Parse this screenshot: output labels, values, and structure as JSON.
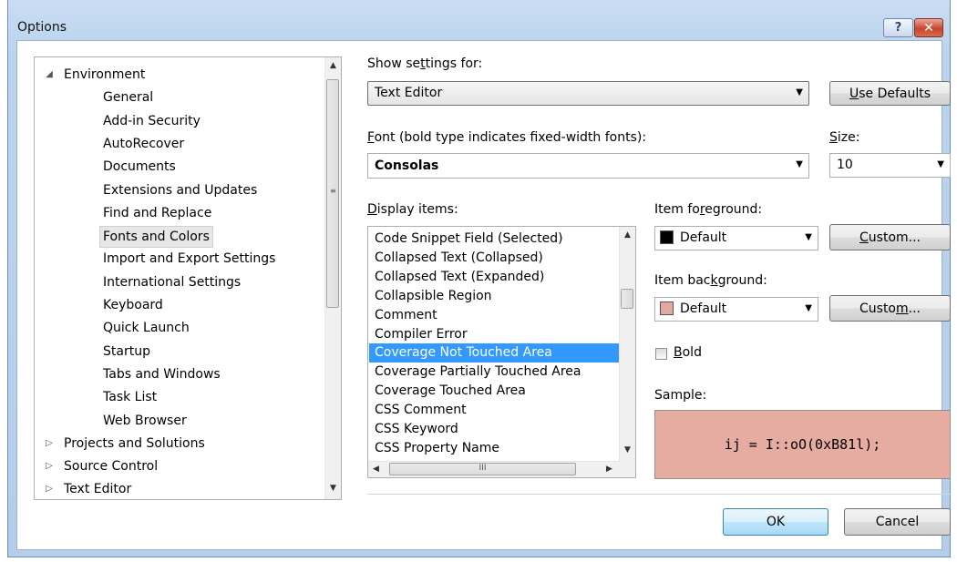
{
  "window": {
    "title": "Options",
    "help_glyph": "?",
    "close_glyph": "✕"
  },
  "tree": {
    "items": [
      {
        "label": "Environment",
        "arrow": "◢"
      },
      {
        "label": "General"
      },
      {
        "label": "Add-in Security"
      },
      {
        "label": "AutoRecover"
      },
      {
        "label": "Documents"
      },
      {
        "label": "Extensions and Updates"
      },
      {
        "label": "Find and Replace"
      },
      {
        "label": "Fonts and Colors",
        "selected": true
      },
      {
        "label": "Import and Export Settings"
      },
      {
        "label": "International Settings"
      },
      {
        "label": "Keyboard"
      },
      {
        "label": "Quick Launch"
      },
      {
        "label": "Startup"
      },
      {
        "label": "Tabs and Windows"
      },
      {
        "label": "Task List"
      },
      {
        "label": "Web Browser"
      },
      {
        "label": "Projects and Solutions",
        "arrow": "▷"
      },
      {
        "label": "Source Control",
        "arrow": "▷"
      },
      {
        "label": "Text Editor",
        "arrow": "▷"
      }
    ]
  },
  "settings": {
    "show_settings_label_pre": "Show se",
    "show_settings_label_u": "t",
    "show_settings_label_post": "tings for:",
    "show_settings_value": "Text Editor",
    "use_defaults_u": "U",
    "use_defaults_rest": "se Defaults",
    "font_label_u": "F",
    "font_label_rest": "ont (bold type indicates fixed-width fonts):",
    "font_value": "Consolas",
    "size_label_u": "S",
    "size_label_rest": "ize:",
    "size_value": "10",
    "display_items_label_u": "D",
    "display_items_label_rest": "isplay items:",
    "display_items": [
      "Code Snippet Field (Selected)",
      "Collapsed Text (Collapsed)",
      "Collapsed Text (Expanded)",
      "Collapsible Region",
      "Comment",
      "Compiler Error",
      "Coverage Not Touched Area",
      "Coverage Partially Touched Area",
      "Coverage Touched Area",
      "CSS Comment",
      "CSS Keyword",
      "CSS Property Name"
    ],
    "selected_item": "Coverage Not Touched Area",
    "fg_label_pre": "Item fo",
    "fg_label_u": "r",
    "fg_label_post": "eground:",
    "fg_value": "Default",
    "fg_swatch_color": "#000000",
    "custom1_u": "C",
    "custom1_rest": "ustom...",
    "bg_label_pre": "Item bac",
    "bg_label_u": "k",
    "bg_label_post": "ground:",
    "bg_value": "Default",
    "bg_swatch_color": "#e3a99e",
    "custom2_pre": "Custo",
    "custom2_u": "m",
    "custom2_post": "...",
    "bold_u": "B",
    "bold_rest": "old",
    "sample_label": "Sample:",
    "sample_text": "ij = I::oO(0xB81l);",
    "sample_bg": "#e6aca2"
  },
  "footer": {
    "ok_label": "OK",
    "cancel_label": "Cancel"
  },
  "icons": {
    "dropdown": "▼",
    "scroll_up": "▲",
    "scroll_down": "▼",
    "scroll_left": "◀",
    "scroll_right": "▶",
    "grip_v": "≡",
    "grip_h": "III"
  }
}
